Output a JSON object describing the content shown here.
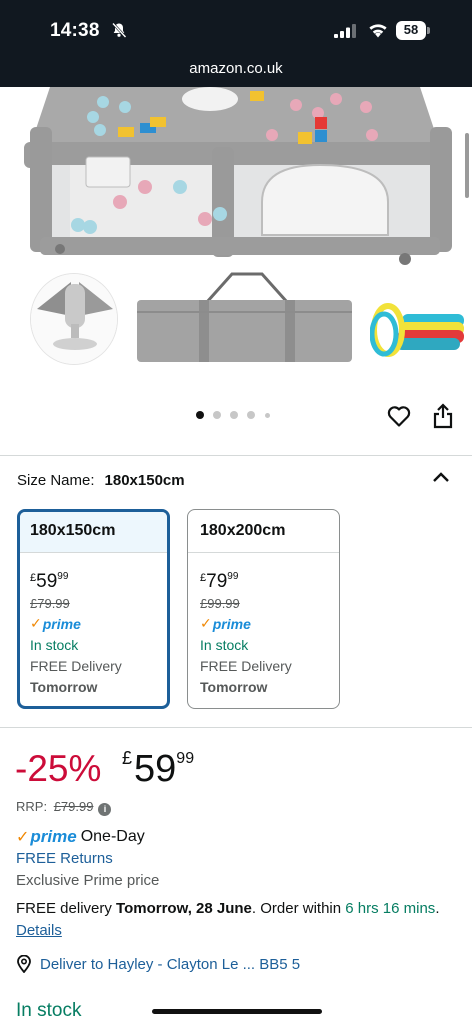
{
  "status_bar": {
    "time": "14:38",
    "battery": "58"
  },
  "browser": {
    "url": "amazon.co.uk"
  },
  "gallery": {
    "dot_count": 5,
    "active_dot": 0
  },
  "size_selector": {
    "label": "Size Name:",
    "selected": "180x150cm",
    "options": [
      {
        "name": "180x150cm",
        "currency": "£",
        "price_whole": "59",
        "price_fraction": "99",
        "rrp": "£79.99",
        "prime": "prime",
        "stock": "In stock",
        "delivery": "FREE Delivery",
        "delivery_day": "Tomorrow",
        "selected": true
      },
      {
        "name": "180x200cm",
        "currency": "£",
        "price_whole": "79",
        "price_fraction": "99",
        "rrp": "£99.99",
        "prime": "prime",
        "stock": "In stock",
        "delivery": "FREE Delivery",
        "delivery_day": "Tomorrow",
        "selected": false
      }
    ]
  },
  "buybox": {
    "discount": "-25%",
    "currency": "£",
    "price_whole": "59",
    "price_fraction": "99",
    "rrp_label": "RRP:",
    "rrp_value": "£79.99",
    "prime_label": "prime",
    "prime_suffix": "One-Day",
    "free_returns": "FREE Returns",
    "exclusive": "Exclusive Prime price",
    "delivery_prefix": "FREE delivery",
    "delivery_date": "Tomorrow, 28 June",
    "order_within": ". Order within",
    "countdown": "6 hrs 16 mins",
    "details_link": "Details",
    "deliver_to": "Deliver to Hayley - Clayton Le ... BB5 5",
    "stock": "In stock"
  },
  "colors": {
    "accent_blue": "#1d5f99",
    "price_red": "#cc0c39",
    "stock_green": "#067d62",
    "prime_orange": "#f08804"
  }
}
